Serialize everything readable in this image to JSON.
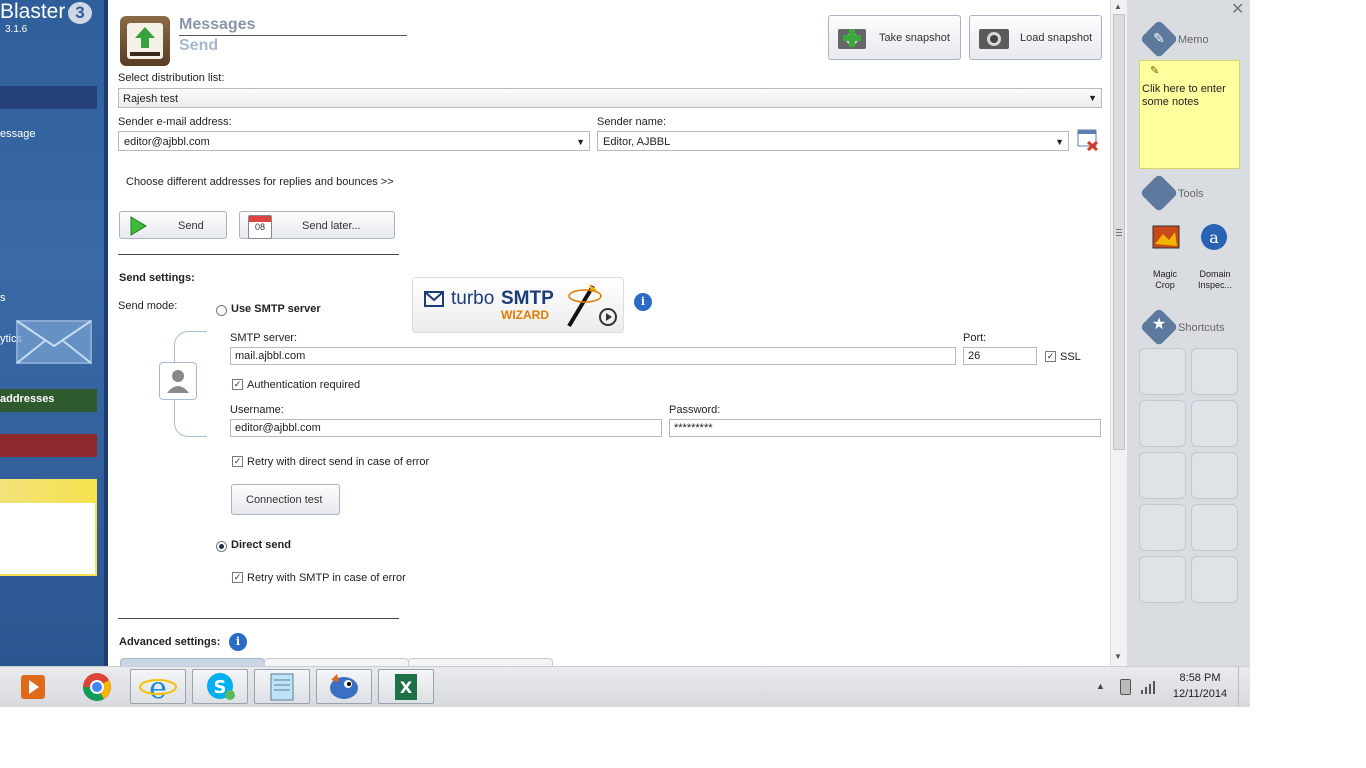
{
  "app": {
    "name": "Blaster",
    "version_badge": "3",
    "version": "3.1.6"
  },
  "leftbar": {
    "items": [
      "essage",
      "s",
      "ytics",
      "addresses"
    ]
  },
  "header": {
    "title": "Messages",
    "subtitle": "Send",
    "take_snapshot": "Take snapshot",
    "load_snapshot": "Load snapshot"
  },
  "form": {
    "distribution_label": "Select distribution list:",
    "distribution_value": "Rajesh test",
    "sender_email_label": "Sender e-mail address:",
    "sender_email_value": "editor@ajbbl.com",
    "sender_name_label": "Sender name:",
    "sender_name_value": "Editor, AJBBL",
    "replies_link": "Choose different addresses for replies and bounces >>",
    "send_button": "Send",
    "send_later_button": "Send later...",
    "calendar_day": "08"
  },
  "send_settings": {
    "heading": "Send settings:",
    "mode_label": "Send mode:",
    "use_smtp": "Use SMTP server",
    "turbo_brand": "turbo",
    "turbo_smtp": "SMTP",
    "turbo_wizard": "WIZARD",
    "smtp_server_label": "SMTP server:",
    "smtp_server_value": "mail.ajbbl.com",
    "port_label": "Port:",
    "port_value": "26",
    "ssl_label": "SSL",
    "auth_label": "Authentication required",
    "username_label": "Username:",
    "username_value": "editor@ajbbl.com",
    "password_label": "Password:",
    "password_value": "*********",
    "retry_direct_label": "Retry with direct send in case of error",
    "connection_test": "Connection test",
    "direct_send": "Direct send",
    "retry_smtp_label": "Retry with SMTP in case of error"
  },
  "advanced": {
    "heading": "Advanced settings:"
  },
  "right_panel": {
    "memo_label": "Memo",
    "memo_text": "Clik here to enter some notes",
    "tools_label": "Tools",
    "tool1": "Magic Crop",
    "tool2": "Domain Inspec...",
    "shortcuts_label": "Shortcuts"
  },
  "taskbar": {
    "time": "8:58 PM",
    "date": "12/11/2014"
  },
  "colors": {
    "accent_blue": "#2f5f9a",
    "smtp_orange": "#e07b00",
    "memo_yellow": "#ffff9e"
  }
}
